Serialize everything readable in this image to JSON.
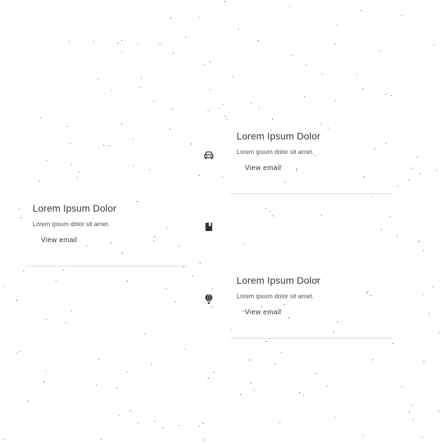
{
  "timeline": {
    "items": [
      {
        "icon": "car-icon",
        "title": "Lorem Ipsum Dolor",
        "text": "Lorem ipsum dolor sit amet.",
        "action": "View email"
      },
      {
        "icon": "book-icon",
        "title": "Lorem Ipsum Dolor",
        "text": "Lorem ipsum dolor sit amet.",
        "action": "View email"
      },
      {
        "icon": "hot-air-balloon-icon",
        "title": "Lorem Ipsum Dolor",
        "text": "Lorem ipsum dolor sit amet.",
        "action": "View email"
      }
    ]
  },
  "colors": {
    "background": "#ffffff",
    "divider": "#d8d8d8",
    "icon": "#2e2e2e",
    "title": "#3a3a3a"
  }
}
